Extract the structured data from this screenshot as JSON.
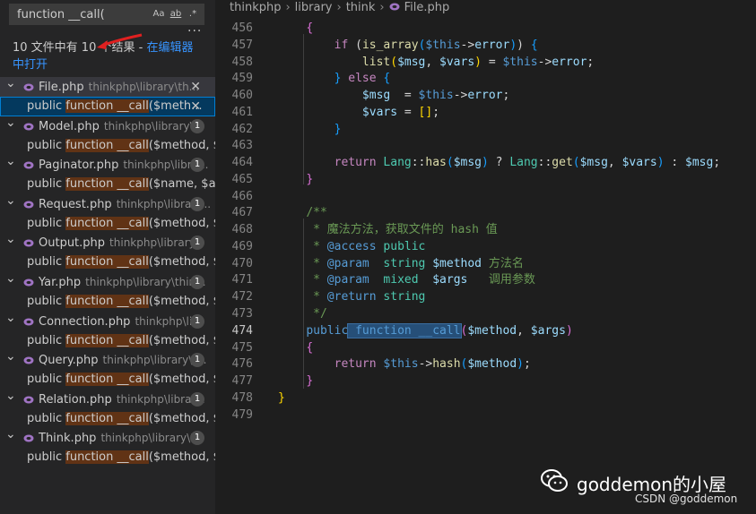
{
  "search": {
    "query": "function __call(",
    "option_case": "Aa",
    "option_word": "ab",
    "option_regex": ".*",
    "more": "···"
  },
  "summary": {
    "text": "10 文件中有 10 个结果 - ",
    "link": "在编辑器中打开"
  },
  "results": [
    {
      "file": "File.php",
      "path": "thinkphp\\library\\th...",
      "count": "",
      "close": "✕",
      "match_prefix": "public ",
      "match_hl": "function __call",
      "match_suffix": "($meth...",
      "selected": true
    },
    {
      "file": "Model.php",
      "path": "thinkphp\\library\\...",
      "count": "1",
      "match_prefix": "public ",
      "match_hl": "function __call",
      "match_suffix": "($method, $ar..."
    },
    {
      "file": "Paginator.php",
      "path": "thinkphp\\libra...",
      "count": "1",
      "match_prefix": "public ",
      "match_hl": "function __call",
      "match_suffix": "($name, $argu..."
    },
    {
      "file": "Request.php",
      "path": "thinkphp\\library...",
      "count": "1",
      "match_prefix": "public ",
      "match_hl": "function __call",
      "match_suffix": "($method, $ar..."
    },
    {
      "file": "Output.php",
      "path": "thinkphp\\library...",
      "count": "1",
      "match_prefix": "public ",
      "match_hl": "function __call",
      "match_suffix": "($method, $ar..."
    },
    {
      "file": "Yar.php",
      "path": "thinkphp\\library\\thin...",
      "count": "1",
      "match_prefix": "public ",
      "match_hl": "function __call",
      "match_suffix": "($method, $ar..."
    },
    {
      "file": "Connection.php",
      "path": "thinkphp\\li...",
      "count": "1",
      "match_prefix": "public ",
      "match_hl": "function __call",
      "match_suffix": "($method, $ar..."
    },
    {
      "file": "Query.php",
      "path": "thinkphp\\library\\t...",
      "count": "1",
      "match_prefix": "public ",
      "match_hl": "function __call",
      "match_suffix": "($method, $ar..."
    },
    {
      "file": "Relation.php",
      "path": "thinkphp\\librar...",
      "count": "1",
      "match_prefix": "public ",
      "match_hl": "function __call",
      "match_suffix": "($method, $ar..."
    },
    {
      "file": "Think.php",
      "path": "thinkphp\\library\\t...",
      "count": "1",
      "match_prefix": "public ",
      "match_hl": "function __call",
      "match_suffix": "($method, $pa..."
    }
  ],
  "breadcrumb": [
    "thinkphp",
    "library",
    "think",
    "File.php"
  ],
  "code": {
    "current_line": "474",
    "lines": [
      {
        "n": "456",
        "tokens": [
          {
            "t": "    "
          },
          {
            "t": "{",
            "c": "br2"
          }
        ]
      },
      {
        "n": "457",
        "tokens": [
          {
            "t": "        "
          },
          {
            "t": "if",
            "c": "ctl"
          },
          {
            "t": " ("
          },
          {
            "t": "is_array",
            "c": "fn"
          },
          {
            "t": "(",
            "c": "br3"
          },
          {
            "t": "$this",
            "c": "kw"
          },
          {
            "t": "->"
          },
          {
            "t": "error",
            "c": "var"
          },
          {
            "t": ")",
            "c": "br3"
          },
          {
            "t": ") "
          },
          {
            "t": "{",
            "c": "br3"
          }
        ]
      },
      {
        "n": "458",
        "tokens": [
          {
            "t": "            "
          },
          {
            "t": "list",
            "c": "fn"
          },
          {
            "t": "(",
            "c": "br1"
          },
          {
            "t": "$msg",
            "c": "var"
          },
          {
            "t": ", "
          },
          {
            "t": "$vars",
            "c": "var"
          },
          {
            "t": ")",
            "c": "br1"
          },
          {
            "t": " = "
          },
          {
            "t": "$this",
            "c": "kw"
          },
          {
            "t": "->"
          },
          {
            "t": "error",
            "c": "var"
          },
          {
            "t": ";"
          }
        ]
      },
      {
        "n": "459",
        "tokens": [
          {
            "t": "        "
          },
          {
            "t": "}",
            "c": "br3"
          },
          {
            "t": " "
          },
          {
            "t": "else",
            "c": "ctl"
          },
          {
            "t": " "
          },
          {
            "t": "{",
            "c": "br3"
          }
        ]
      },
      {
        "n": "460",
        "tokens": [
          {
            "t": "            "
          },
          {
            "t": "$msg",
            "c": "var"
          },
          {
            "t": "  = "
          },
          {
            "t": "$this",
            "c": "kw"
          },
          {
            "t": "->"
          },
          {
            "t": "error",
            "c": "var"
          },
          {
            "t": ";"
          }
        ]
      },
      {
        "n": "461",
        "tokens": [
          {
            "t": "            "
          },
          {
            "t": "$vars",
            "c": "var"
          },
          {
            "t": " = "
          },
          {
            "t": "[]",
            "c": "br1"
          },
          {
            "t": ";"
          }
        ]
      },
      {
        "n": "462",
        "tokens": [
          {
            "t": "        "
          },
          {
            "t": "}",
            "c": "br3"
          }
        ]
      },
      {
        "n": "463",
        "tokens": [
          {
            "t": ""
          }
        ]
      },
      {
        "n": "464",
        "tokens": [
          {
            "t": "        "
          },
          {
            "t": "return",
            "c": "ctl"
          },
          {
            "t": " "
          },
          {
            "t": "Lang",
            "c": "cls"
          },
          {
            "t": "::"
          },
          {
            "t": "has",
            "c": "fn"
          },
          {
            "t": "(",
            "c": "br3"
          },
          {
            "t": "$msg",
            "c": "var"
          },
          {
            "t": ")",
            "c": "br3"
          },
          {
            "t": " ? "
          },
          {
            "t": "Lang",
            "c": "cls"
          },
          {
            "t": "::"
          },
          {
            "t": "get",
            "c": "fn"
          },
          {
            "t": "(",
            "c": "br3"
          },
          {
            "t": "$msg",
            "c": "var"
          },
          {
            "t": ", "
          },
          {
            "t": "$vars",
            "c": "var"
          },
          {
            "t": ")",
            "c": "br3"
          },
          {
            "t": " : "
          },
          {
            "t": "$msg",
            "c": "var"
          },
          {
            "t": ";"
          }
        ]
      },
      {
        "n": "465",
        "tokens": [
          {
            "t": "    "
          },
          {
            "t": "}",
            "c": "br2"
          }
        ]
      },
      {
        "n": "466",
        "tokens": [
          {
            "t": ""
          }
        ]
      },
      {
        "n": "467",
        "tokens": [
          {
            "t": "    "
          },
          {
            "t": "/**",
            "c": "cm"
          }
        ]
      },
      {
        "n": "468",
        "tokens": [
          {
            "t": "    "
          },
          {
            "t": " * 魔法方法，获取文件的 hash 值",
            "c": "cm"
          }
        ]
      },
      {
        "n": "469",
        "tokens": [
          {
            "t": "    "
          },
          {
            "t": " * ",
            "c": "cm"
          },
          {
            "t": "@access",
            "c": "kw"
          },
          {
            "t": " ",
            "c": "cm"
          },
          {
            "t": "public",
            "c": "cls"
          }
        ]
      },
      {
        "n": "470",
        "tokens": [
          {
            "t": "    "
          },
          {
            "t": " * ",
            "c": "cm"
          },
          {
            "t": "@param",
            "c": "kw"
          },
          {
            "t": "  ",
            "c": "cm"
          },
          {
            "t": "string",
            "c": "cls"
          },
          {
            "t": " ",
            "c": "cm"
          },
          {
            "t": "$method",
            "c": "var"
          },
          {
            "t": " 方法名",
            "c": "cm"
          }
        ]
      },
      {
        "n": "471",
        "tokens": [
          {
            "t": "    "
          },
          {
            "t": " * ",
            "c": "cm"
          },
          {
            "t": "@param",
            "c": "kw"
          },
          {
            "t": "  ",
            "c": "cm"
          },
          {
            "t": "mixed",
            "c": "cls"
          },
          {
            "t": "  ",
            "c": "cm"
          },
          {
            "t": "$args",
            "c": "var"
          },
          {
            "t": "   调用参数",
            "c": "cm"
          }
        ]
      },
      {
        "n": "472",
        "tokens": [
          {
            "t": "    "
          },
          {
            "t": " * ",
            "c": "cm"
          },
          {
            "t": "@return",
            "c": "kw"
          },
          {
            "t": " ",
            "c": "cm"
          },
          {
            "t": "string",
            "c": "cls"
          }
        ]
      },
      {
        "n": "473",
        "tokens": [
          {
            "t": "    "
          },
          {
            "t": " */",
            "c": "cm"
          }
        ]
      },
      {
        "n": "474",
        "tokens": [
          {
            "t": "    "
          },
          {
            "t": "public",
            "c": "kw"
          },
          {
            "t": " function __call",
            "c": "kw",
            "hl": true
          },
          {
            "t": "(",
            "c": "br2"
          },
          {
            "t": "$method",
            "c": "var"
          },
          {
            "t": ", "
          },
          {
            "t": "$args",
            "c": "var"
          },
          {
            "t": ")",
            "c": "br2"
          }
        ]
      },
      {
        "n": "475",
        "tokens": [
          {
            "t": "    "
          },
          {
            "t": "{",
            "c": "br2"
          }
        ]
      },
      {
        "n": "476",
        "tokens": [
          {
            "t": "        "
          },
          {
            "t": "return",
            "c": "ctl"
          },
          {
            "t": " "
          },
          {
            "t": "$this",
            "c": "kw"
          },
          {
            "t": "->"
          },
          {
            "t": "hash",
            "c": "fn"
          },
          {
            "t": "(",
            "c": "br3"
          },
          {
            "t": "$method",
            "c": "var"
          },
          {
            "t": ")",
            "c": "br3"
          },
          {
            "t": ";"
          }
        ]
      },
      {
        "n": "477",
        "tokens": [
          {
            "t": "    "
          },
          {
            "t": "}",
            "c": "br2"
          }
        ]
      },
      {
        "n": "478",
        "tokens": [
          {
            "t": "}",
            "c": "br1"
          }
        ]
      },
      {
        "n": "479",
        "tokens": [
          {
            "t": ""
          }
        ]
      }
    ]
  },
  "watermark": {
    "title": "goddemon的小屋",
    "csdn": "CSDN @goddemon"
  },
  "colors": {
    "php_icon": "#a074c4",
    "match_highlight": "#613315",
    "link": "#3794ff",
    "red_arrow": "#e02020"
  }
}
